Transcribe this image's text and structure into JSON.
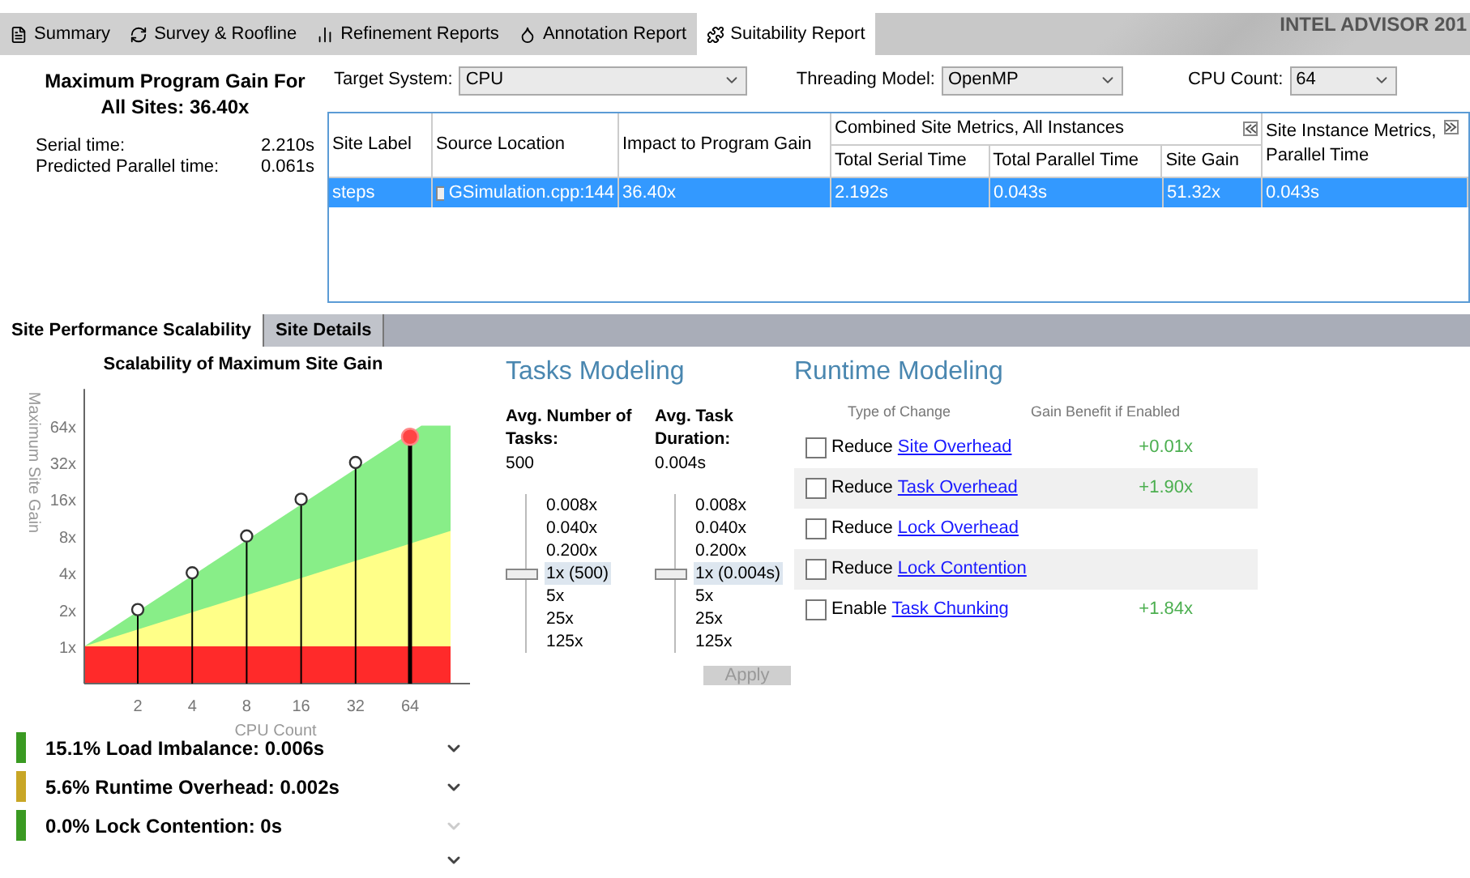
{
  "tabs": [
    {
      "label": "Summary",
      "selected": false
    },
    {
      "label": "Survey & Roofline",
      "selected": false
    },
    {
      "label": "Refinement Reports",
      "selected": false
    },
    {
      "label": "Annotation Report",
      "selected": false
    },
    {
      "label": "Suitability Report",
      "selected": true
    }
  ],
  "brand": "INTEL ADVISOR 201",
  "summary": {
    "title": "Maximum Program Gain For All Sites: 36.40x",
    "stats": [
      {
        "label": "Serial time:",
        "value": "2.210s"
      },
      {
        "label": "Predicted Parallel time:",
        "value": "0.061s"
      }
    ]
  },
  "selectors": [
    {
      "label": "Target System:",
      "value": "CPU"
    },
    {
      "label": "Threading Model:",
      "value": "OpenMP"
    },
    {
      "label": "CPU Count:",
      "value": "64"
    }
  ],
  "table": {
    "columns": [
      "Site Label",
      "Source Location",
      "Impact to Program Gain"
    ],
    "group": {
      "title": "Combined Site Metrics, All Instances",
      "columns": [
        "Total Serial Time",
        "Total Parallel Time",
        "Site Gain"
      ]
    },
    "last_column": "Site Instance Metrics, Parallel Time",
    "rows": [
      {
        "selected": true,
        "cells": [
          "steps",
          "GSimulation.cpp:144",
          "36.40x",
          "2.192s",
          "0.043s",
          "51.32x",
          "0.043s"
        ]
      }
    ]
  },
  "lower_tabs": [
    {
      "label": "Site Performance Scalability",
      "selected": true
    },
    {
      "label": "Site Details",
      "selected": false
    }
  ],
  "scalability": {
    "chart": {
      "title": "Scalability of Maximum Site Gain",
      "xlabel": "CPU Count",
      "ylabel": "Maximum Site Gain",
      "x_labels": [
        "2",
        "4",
        "8",
        "16",
        "32",
        "64"
      ],
      "y_labels": [
        "64x",
        "32x",
        "16x",
        "8x",
        "4x",
        "2x",
        "1x"
      ]
    },
    "metrics": [
      {
        "text": "15.1% Load Imbalance: 0.006s",
        "color": "#3a9a22",
        "disabled": false
      },
      {
        "text": "5.6% Runtime Overhead: 0.002s",
        "color": "#c8a626",
        "disabled": false
      },
      {
        "text": "0.0% Lock Contention: 0s",
        "color": "#3a9a22",
        "disabled": true
      }
    ]
  },
  "tasks_modeling": {
    "title": "Tasks Modeling",
    "sliders": [
      {
        "label": "Avg. Number of Tasks:",
        "value": "500",
        "level": 0.5,
        "ticks": [
          "0.008x",
          "0.040x",
          "0.200x",
          "1x (500)",
          "5x",
          "25x",
          "125x"
        ]
      },
      {
        "label": "Avg. Task Duration:",
        "value": "0.004s",
        "level": 0.5,
        "ticks": [
          "0.008x",
          "0.040x",
          "0.200x",
          "1x (0.004s)",
          "5x",
          "25x",
          "125x"
        ]
      }
    ],
    "apply": {
      "label": "Apply",
      "disabled": true
    }
  },
  "runtime_modeling": {
    "title": "Runtime Modeling",
    "columns": [
      "Type of Change",
      "Gain Benefit if Enabled"
    ],
    "rows": [
      {
        "verb": "Reduce",
        "link": "Site Overhead",
        "gain": "+0.01x",
        "checked": false
      },
      {
        "verb": "Reduce",
        "link": "Task Overhead",
        "gain": "+1.90x",
        "checked": false
      },
      {
        "verb": "Reduce",
        "link": "Lock Overhead",
        "checked": false
      },
      {
        "verb": "Reduce",
        "link": "Lock Contention",
        "checked": false
      },
      {
        "verb": "Enable",
        "link": "Task Chunking",
        "gain": "+1.84x",
        "checked": false
      }
    ]
  }
}
